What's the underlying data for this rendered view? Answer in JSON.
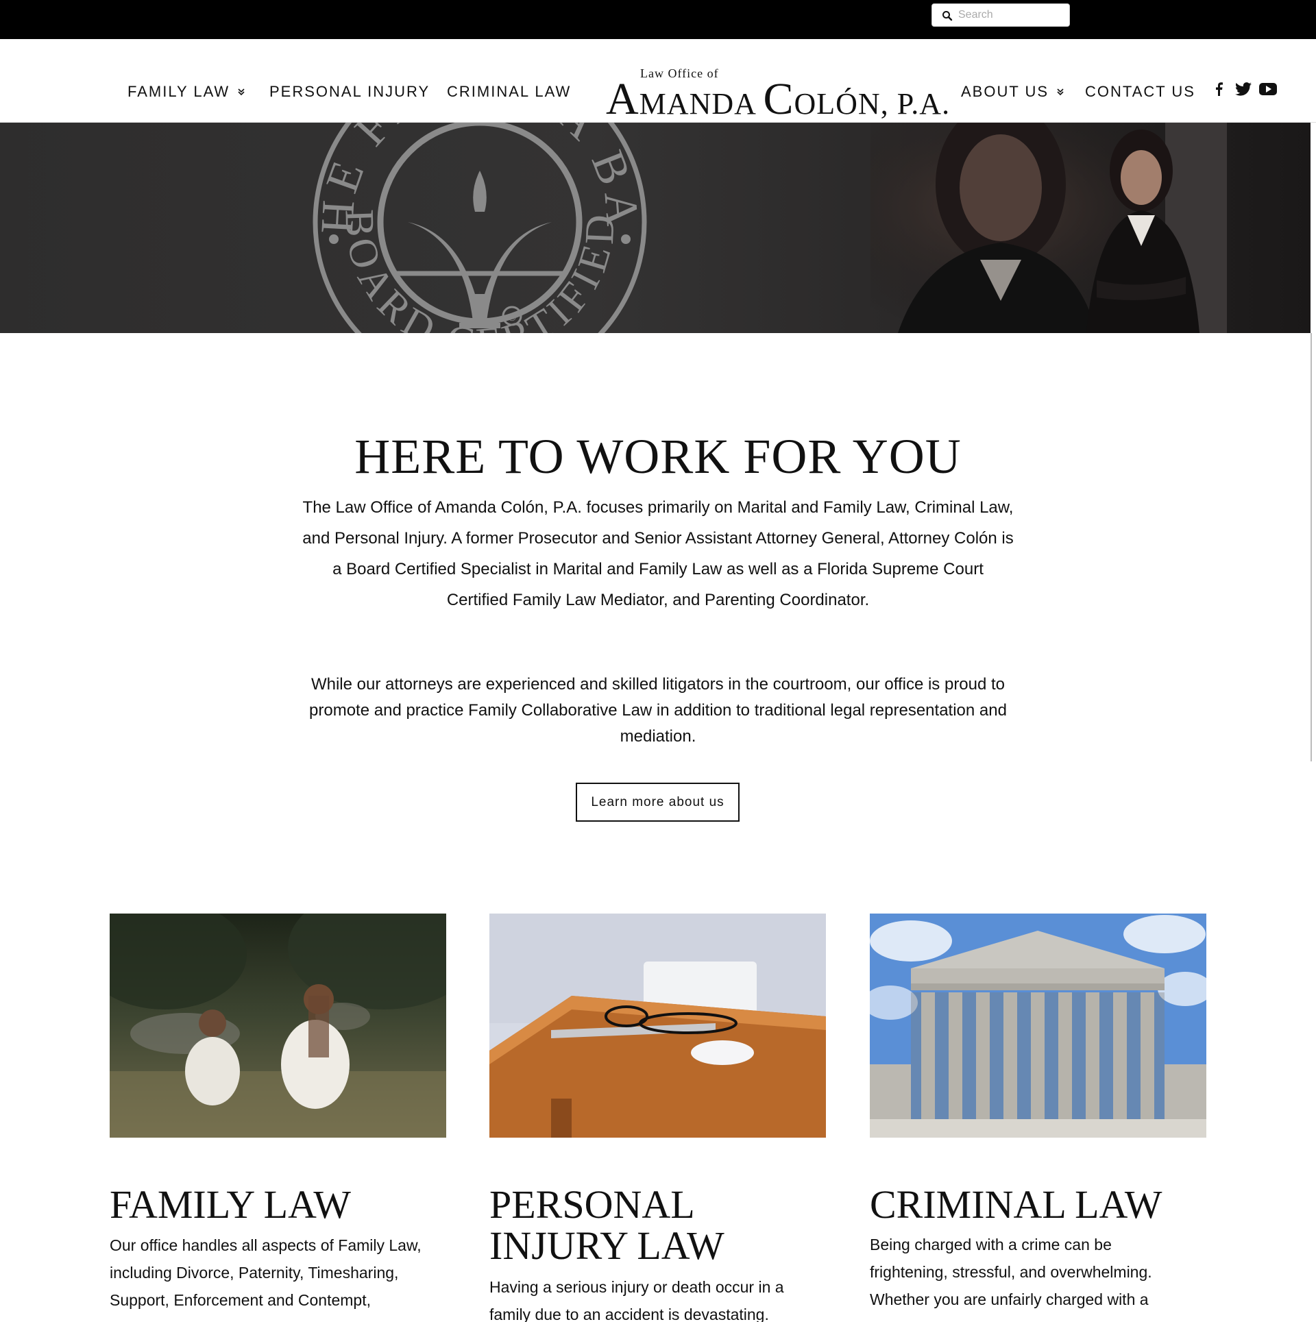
{
  "search": {
    "placeholder": "Search"
  },
  "nav": {
    "family_law": "FAMILY LAW",
    "personal_injury": "PERSONAL INJURY",
    "criminal_law": "CRIMINAL LAW",
    "about_us": "ABOUT US",
    "contact_us": "CONTACT US",
    "dropdown_glyph": "»"
  },
  "logo": {
    "line1": "Law Office of",
    "line2_cap1": "A",
    "line2_rest1": "MANDA",
    "line2_cap2": "C",
    "line2_rest2": "OLÓN, P.A."
  },
  "social": [
    "facebook-icon",
    "twitter-icon",
    "youtube-icon"
  ],
  "hero": {
    "seal_top": "THE FLORIDA BAR",
    "seal_bottom": "BOARD CERTIFIED",
    "seal_mark": "®"
  },
  "intro": {
    "title": "HERE TO WORK FOR YOU",
    "p1": "The Law Office of Amanda Colón, P.A. focuses primarily on Marital and Family Law, Criminal Law, and Personal Injury. A former Prosecutor and Senior Assistant Attorney General, Attorney Colón is a Board Certified Specialist in Marital and Family Law as well as a Florida Supreme Court Certified Family Law Mediator, and Parenting Coordinator.",
    "p2": "While our attorneys are experienced and skilled litigators in the courtroom, our office is proud to promote and practice Family Collaborative Law in addition to traditional legal representation and mediation.",
    "button": "Learn more about us"
  },
  "cards": [
    {
      "title": "FAMILY LAW",
      "text": "Our office handles all aspects of Family Law, including Divorce, Paternity, Timesharing, Support, Enforcement and Contempt,"
    },
    {
      "title_line1": "PERSONAL",
      "title_line2": "INJURY LAW",
      "text": "Having a serious injury or death occur in a family due to an accident is devastating."
    },
    {
      "title": "CRIMINAL LAW",
      "text": "Being charged with a crime can be frightening, stressful, and overwhelming. Whether you are unfairly charged with a"
    }
  ],
  "colors": {
    "topbar": "#000000",
    "hero": "#2e2d2d",
    "text": "#111111"
  }
}
